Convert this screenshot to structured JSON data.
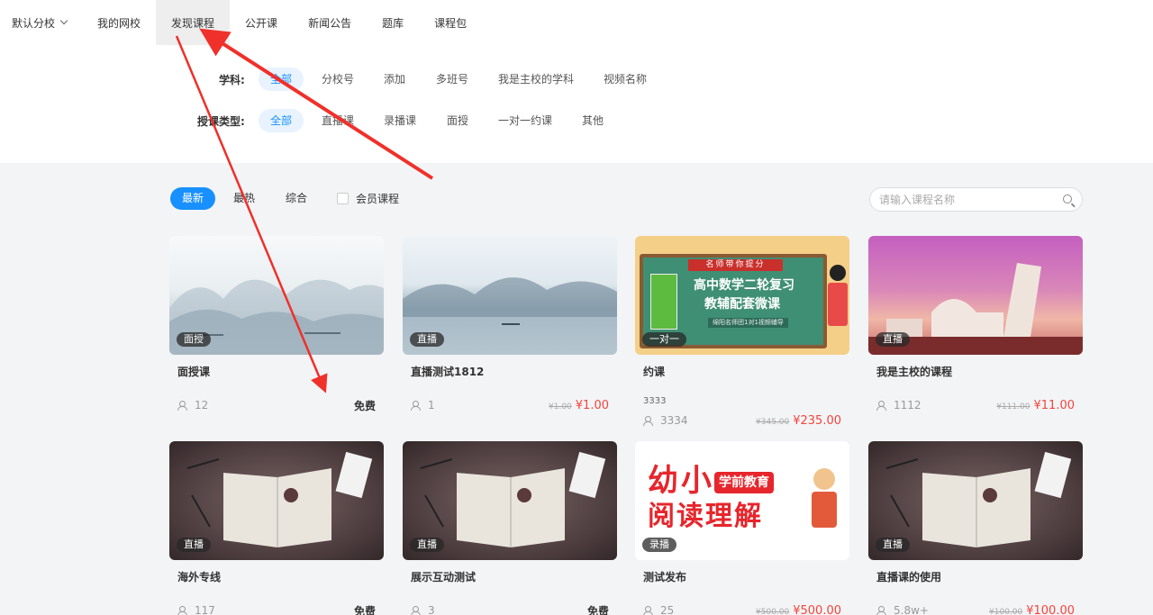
{
  "nav": {
    "branch": "默认分校",
    "items": [
      "我的网校",
      "发现课程",
      "公开课",
      "新闻公告",
      "题库",
      "课程包"
    ],
    "active_index": 1
  },
  "filters": {
    "subject_label": "学科:",
    "subjects": [
      "全部",
      "分校号",
      "添加",
      "多班号",
      "我是主校的学科",
      "视频名称"
    ],
    "subject_active": 0,
    "type_label": "授课类型:",
    "types": [
      "全部",
      "直播课",
      "录播课",
      "面授",
      "一对一约课",
      "其他"
    ],
    "type_active": 0
  },
  "sort": {
    "options": [
      "最新",
      "最热",
      "综合"
    ],
    "active": 0,
    "member_label": "会员课程",
    "member_checked": false
  },
  "search": {
    "placeholder": "请输入课程名称"
  },
  "courses": [
    {
      "badge": "面授",
      "title": "面授课",
      "count": "12",
      "free_label": "免费"
    },
    {
      "badge": "直播",
      "title": "直播测试1812",
      "count": "1",
      "old_price": "¥1.00",
      "price": "¥1.00"
    },
    {
      "badge": "一对一",
      "title": "约课",
      "subtitle": "3333",
      "count": "3334",
      "old_price": "¥345.00",
      "price": "¥235.00",
      "poster": {
        "tag": "名师带你提分",
        "line1": "高中数学二轮复习",
        "line2": "教辅配套微课",
        "foot": "绵阳名师团1对1视频辅导"
      }
    },
    {
      "badge": "直播",
      "title": "我是主校的课程",
      "count": "1112",
      "old_price": "¥111.00",
      "price": "¥11.00"
    },
    {
      "badge": "直播",
      "title": "海外专线",
      "count": "117",
      "free_label": "免费"
    },
    {
      "badge": "直播",
      "title": "展示互动测试",
      "count": "3",
      "free_label": "免费"
    },
    {
      "badge": "录播",
      "title": "测试发布",
      "count": "25",
      "old_price": "¥500.00",
      "price": "¥500.00",
      "poster": {
        "big1": "幼小",
        "tag": "学前教育",
        "big2": "阅读理解"
      }
    },
    {
      "badge": "直播",
      "title": "直播课的使用",
      "count": "5.8w+",
      "old_price": "¥100.00",
      "price": "¥100.00"
    }
  ],
  "colors": {
    "accent": "#1890ff",
    "price": "#f2453d",
    "annotation": "#f0302a"
  }
}
